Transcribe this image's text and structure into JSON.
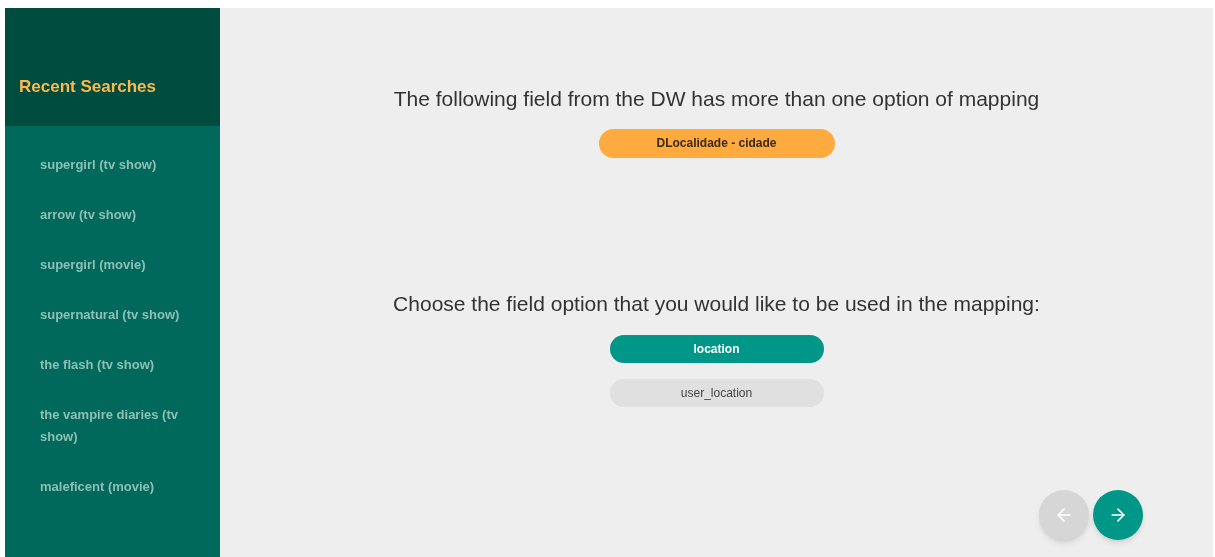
{
  "sidebar": {
    "title": "Recent Searches",
    "items": [
      {
        "label": "supergirl (tv show)"
      },
      {
        "label": "arrow (tv show)"
      },
      {
        "label": "supergirl (movie)"
      },
      {
        "label": "supernatural (tv show)"
      },
      {
        "label": "the flash (tv show)"
      },
      {
        "label": "the vampire diaries (tv show)"
      },
      {
        "label": "maleficent (movie)"
      }
    ]
  },
  "heading": "The following field from the DW has more than one option of mapping",
  "field": "DLocalidade - cidade",
  "prompt": "Choose the field option that you would like to be used in the mapping:",
  "options": [
    {
      "label": "location",
      "selected": true
    },
    {
      "label": "user_location",
      "selected": false
    }
  ],
  "nav": {
    "back": {
      "disabled": true
    },
    "next": {
      "disabled": false
    }
  }
}
